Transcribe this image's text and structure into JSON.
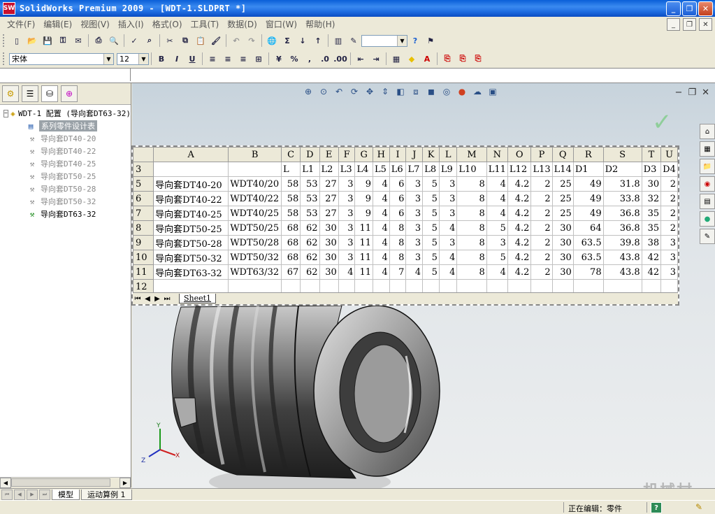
{
  "window": {
    "title": "SolidWorks Premium 2009 - [WDT-1.SLDPRT *]",
    "icon": "sw-logo-icon"
  },
  "menu": [
    "文件(F)",
    "编辑(E)",
    "视图(V)",
    "插入(I)",
    "格式(O)",
    "工具(T)",
    "数据(D)",
    "窗口(W)",
    "帮助(H)"
  ],
  "toolbar": {
    "font_name": "宋体",
    "font_size": "12"
  },
  "tree": {
    "root": "WDT-1 配置  (导向套DT63-32)",
    "design_table": "系列零件设计表",
    "configs": [
      "导向套DT40-20",
      "导向套DT40-22",
      "导向套DT40-25",
      "导向套DT50-25",
      "导向套DT50-28",
      "导向套DT50-32",
      "导向套DT63-32"
    ],
    "active_config_index": 6
  },
  "bottom_tabs": [
    "模型",
    "运动算例 1"
  ],
  "status": {
    "text": "正在编辑：零件"
  },
  "watermark": "机械村",
  "sheet": {
    "tab_name": "Sheet1",
    "col_letters": [
      "A",
      "B",
      "C",
      "D",
      "E",
      "F",
      "G",
      "H",
      "I",
      "J",
      "K",
      "L",
      "M",
      "N",
      "O",
      "P",
      "Q",
      "R",
      "S",
      "T",
      "U"
    ],
    "header_row": {
      "num": "3",
      "cells": [
        "",
        "",
        "L",
        "L1",
        "L2",
        "L3",
        "L4",
        "L5",
        "L6",
        "L7",
        "L8",
        "L9",
        "L10",
        "L11",
        "L12",
        "L13",
        "L14",
        "D1",
        "D2",
        "D3",
        "D4"
      ]
    },
    "rows": [
      {
        "num": "5",
        "cells": [
          "导向套DT40-20",
          "WDT40/20",
          "58",
          "53",
          "27",
          "3",
          "9",
          "4",
          "6",
          "3",
          "5",
          "3",
          "8",
          "4",
          "4.2",
          "2",
          "25",
          "49",
          "31.8",
          "30",
          "2"
        ]
      },
      {
        "num": "6",
        "cells": [
          "导向套DT40-22",
          "WDT40/22",
          "58",
          "53",
          "27",
          "3",
          "9",
          "4",
          "6",
          "3",
          "5",
          "3",
          "8",
          "4",
          "4.2",
          "2",
          "25",
          "49",
          "33.8",
          "32",
          "2"
        ]
      },
      {
        "num": "7",
        "cells": [
          "导向套DT40-25",
          "WDT40/25",
          "58",
          "53",
          "27",
          "3",
          "9",
          "4",
          "6",
          "3",
          "5",
          "3",
          "8",
          "4",
          "4.2",
          "2",
          "25",
          "49",
          "36.8",
          "35",
          "2"
        ]
      },
      {
        "num": "8",
        "cells": [
          "导向套DT50-25",
          "WDT50/25",
          "68",
          "62",
          "30",
          "3",
          "11",
          "4",
          "8",
          "3",
          "5",
          "4",
          "8",
          "5",
          "4.2",
          "2",
          "30",
          "64",
          "36.8",
          "35",
          "2"
        ]
      },
      {
        "num": "9",
        "cells": [
          "导向套DT50-28",
          "WDT50/28",
          "68",
          "62",
          "30",
          "3",
          "11",
          "4",
          "8",
          "3",
          "5",
          "3",
          "8",
          "3",
          "4.2",
          "2",
          "30",
          "63.5",
          "39.8",
          "38",
          "3"
        ]
      },
      {
        "num": "10",
        "cells": [
          "导向套DT50-32",
          "WDT50/32",
          "68",
          "62",
          "30",
          "3",
          "11",
          "4",
          "8",
          "3",
          "5",
          "4",
          "8",
          "5",
          "4.2",
          "2",
          "30",
          "63.5",
          "43.8",
          "42",
          "3"
        ]
      },
      {
        "num": "11",
        "cells": [
          "导向套DT63-32",
          "WDT63/32",
          "67",
          "62",
          "30",
          "4",
          "11",
          "4",
          "7",
          "4",
          "5",
          "4",
          "8",
          "4",
          "4.2",
          "2",
          "30",
          "78",
          "43.8",
          "42",
          "3"
        ]
      },
      {
        "num": "12",
        "cells": [
          "",
          "",
          "",
          "",
          "",
          "",
          "",
          "",
          "",
          "",
          "",
          "",
          "",
          "",
          "",
          "",
          "",
          "",
          "",
          "",
          ""
        ]
      }
    ]
  },
  "triad": {
    "x": "X",
    "y": "Y",
    "z": "Z"
  }
}
